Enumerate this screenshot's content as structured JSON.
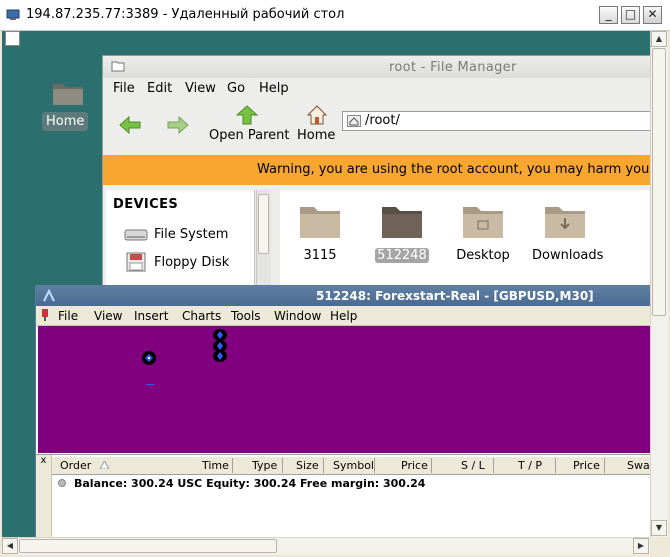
{
  "rdp": {
    "title": "194.87.235.77:3389 - Удаленный рабочий стол",
    "buttons": {
      "minimize": "_",
      "maximize": "□",
      "close": "✕"
    }
  },
  "desktop": {
    "home_label": "Home"
  },
  "file_manager": {
    "title": "root - File Manager",
    "menu": [
      "File",
      "Edit",
      "View",
      "Go",
      "Help"
    ],
    "toolbar": {
      "open_parent": "Open Parent",
      "home": "Home"
    },
    "address": "/root/",
    "warning": "Warning, you are using the root account, you may harm your s",
    "sidebar": {
      "header": "DEVICES",
      "items": [
        "File System",
        "Floppy Disk"
      ]
    },
    "folders": [
      "3115",
      "512248",
      "Desktop",
      "Downloads"
    ],
    "selected_folder": "512248"
  },
  "mt4": {
    "title": "512248: Forexstart-Real - [GBPUSD,M30]",
    "menu": [
      "File",
      "View",
      "Insert",
      "Charts",
      "Tools",
      "Window",
      "Help"
    ],
    "chart_bg": "#800080",
    "terminal": {
      "close": "x",
      "columns": [
        "Order",
        "Time",
        "Type",
        "Size",
        "Symbol",
        "Price",
        "S / L",
        "T / P",
        "Price",
        "Swap"
      ],
      "balance_row": "Balance: 300.24 USC  Equity: 300.24  Free margin: 300.24"
    }
  },
  "colors": {
    "warning": "#f7a630",
    "desktop": "#2b6f6f",
    "mt_title": "#4a6b93"
  }
}
